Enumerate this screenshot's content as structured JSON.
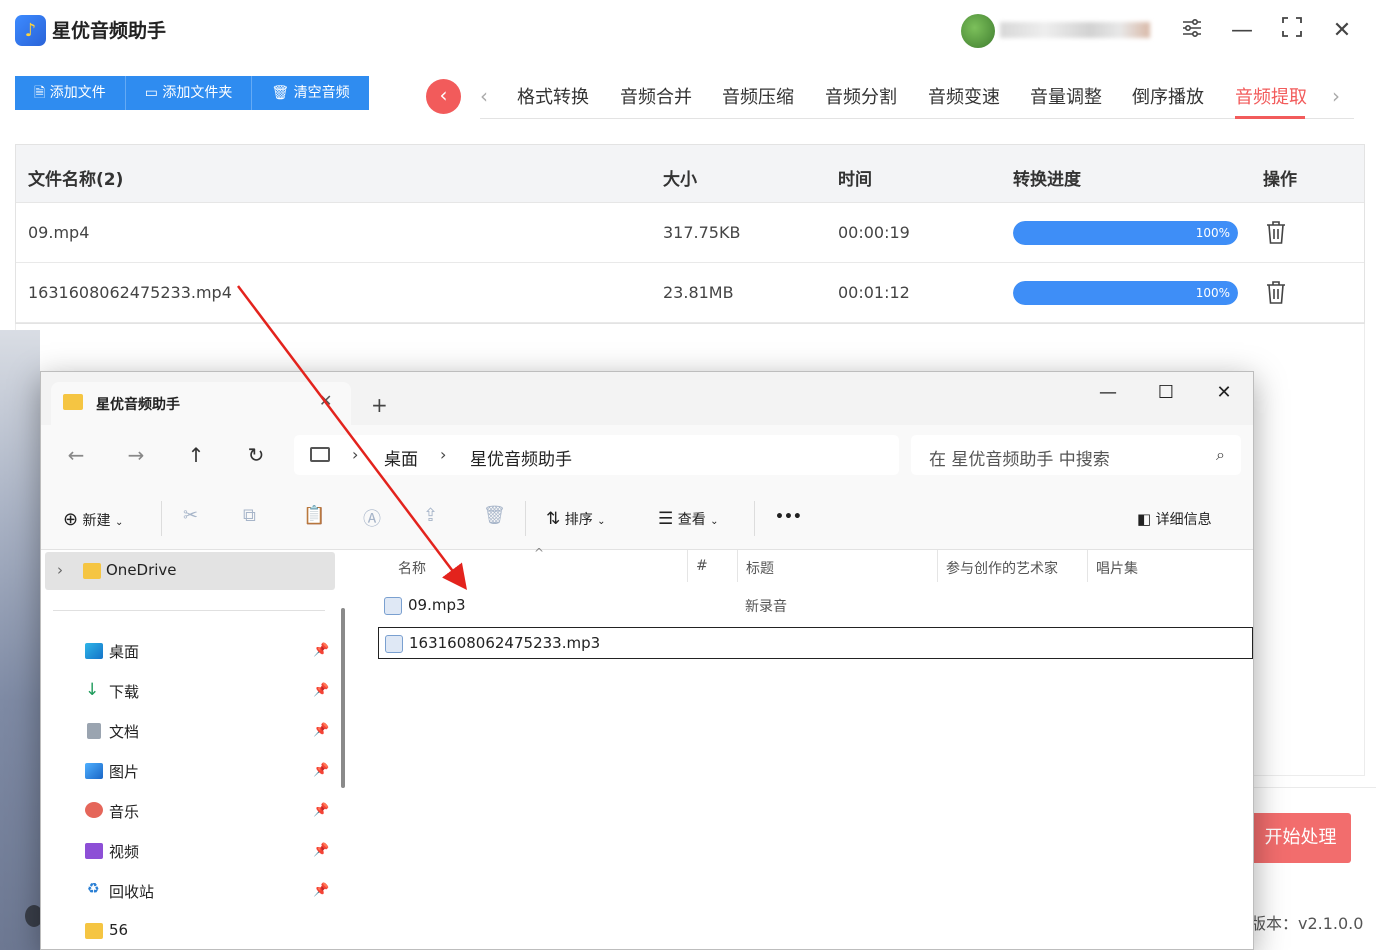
{
  "app": {
    "title": "星优音频助手",
    "version": "版本：v2.1.0.0",
    "toolbar": {
      "add_file": "添加文件",
      "add_folder": "添加文件夹",
      "clear": "清空音频"
    },
    "tabs": [
      "格式转换",
      "音频合并",
      "音频压缩",
      "音频分割",
      "音频变速",
      "音量调整",
      "倒序播放",
      "音频提取"
    ],
    "active_tab": "音频提取",
    "table": {
      "headers": {
        "name": "文件名称(2)",
        "size": "大小",
        "time": "时间",
        "progress": "转换进度",
        "action": "操作"
      },
      "rows": [
        {
          "name": "09.mp4",
          "size": "317.75KB",
          "time": "00:00:19",
          "progress_label": "100%",
          "progress": 1.0
        },
        {
          "name": "1631608062475233.mp4",
          "size": "23.81MB",
          "time": "00:01:12",
          "progress_label": "100%",
          "progress": 1.0
        }
      ]
    },
    "start_button": "开始处理",
    "accent": "#f25b5b",
    "primary": "#2f8cf0"
  },
  "explorer": {
    "tab_title": "星优音频助手",
    "breadcrumb": [
      "桌面",
      "星优音频助手"
    ],
    "search_placeholder": "在 星优音频助手 中搜索",
    "commands": {
      "new": "新建",
      "sort": "排序",
      "view": "查看",
      "more": "•••",
      "details": "详细信息"
    },
    "nav": {
      "onedrive": "OneDrive",
      "quick": [
        {
          "label": "桌面"
        },
        {
          "label": "下载"
        },
        {
          "label": "文档"
        },
        {
          "label": "图片"
        },
        {
          "label": "音乐"
        },
        {
          "label": "视频"
        },
        {
          "label": "回收站"
        },
        {
          "label": "56"
        }
      ]
    },
    "columns": {
      "name": "名称",
      "num": "#",
      "title": "标题",
      "artist": "参与创作的艺术家",
      "album": "唱片集"
    },
    "files": [
      {
        "name": "09.mp3",
        "title": "新录音"
      },
      {
        "name": "1631608062475233.mp3",
        "title": ""
      }
    ]
  }
}
